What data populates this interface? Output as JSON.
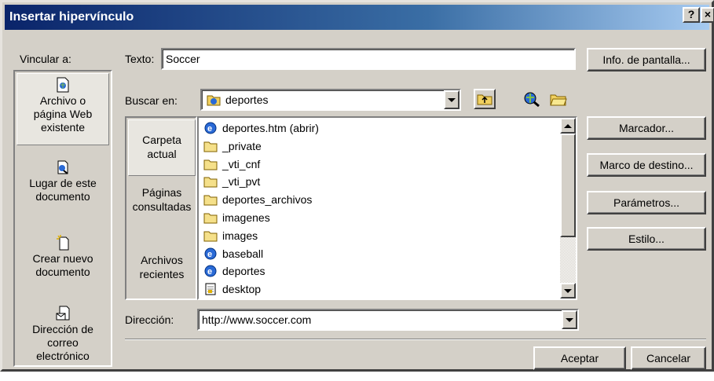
{
  "window": {
    "title": "Insertar hipervínculo",
    "help_label": "?",
    "close_label": "×"
  },
  "link_to": {
    "label": "Vincular a:",
    "items": [
      {
        "line1": "Archivo o",
        "line2": "página Web",
        "line3": "existente",
        "icon": "web-page-icon",
        "selected": true
      },
      {
        "line1": "Lugar de este",
        "line2": "documento",
        "line3": "",
        "icon": "place-in-document-icon",
        "selected": false
      },
      {
        "line1": "Crear nuevo",
        "line2": "documento",
        "line3": "",
        "icon": "new-document-icon",
        "selected": false
      },
      {
        "line1": "Dirección de",
        "line2": "correo",
        "line3": "electrónico",
        "icon": "email-address-icon",
        "selected": false
      }
    ]
  },
  "text_field": {
    "label": "Texto:",
    "value": "Soccer"
  },
  "screen_tip_button": "Info. de pantalla...",
  "look_in": {
    "label": "Buscar en:",
    "value": "deportes",
    "icon": "web-folder-icon"
  },
  "toolbar": {
    "up_folder": "up-folder-icon",
    "browse_web": "browse-web-icon",
    "browse_file": "browse-file-icon"
  },
  "places": [
    {
      "line1": "Carpeta",
      "line2": "actual",
      "selected": true
    },
    {
      "line1": "Páginas",
      "line2": "consultadas",
      "selected": false
    },
    {
      "line1": "Archivos",
      "line2": "recientes",
      "selected": false
    }
  ],
  "files": [
    {
      "name": "deportes.htm (abrir)",
      "icon": "ie-page-icon"
    },
    {
      "name": "_private",
      "icon": "folder-icon"
    },
    {
      "name": "_vti_cnf",
      "icon": "folder-icon"
    },
    {
      "name": "_vti_pvt",
      "icon": "folder-icon"
    },
    {
      "name": "deportes_archivos",
      "icon": "folder-icon"
    },
    {
      "name": "imagenes",
      "icon": "folder-icon"
    },
    {
      "name": "images",
      "icon": "folder-icon"
    },
    {
      "name": "baseball",
      "icon": "ie-page-icon"
    },
    {
      "name": "deportes",
      "icon": "ie-page-icon"
    },
    {
      "name": "desktop",
      "icon": "ini-file-icon"
    }
  ],
  "right_buttons": {
    "bookmark": "Marcador...",
    "target_frame": "Marco de destino...",
    "parameters": "Parámetros...",
    "style": "Estilo..."
  },
  "address": {
    "label": "Dirección:",
    "value": "http://www.soccer.com"
  },
  "footer": {
    "ok": "Aceptar",
    "cancel": "Cancelar"
  },
  "colors": {
    "titlebar_start": "#0a246a",
    "titlebar_end": "#a6caf0",
    "face": "#d4d0c8"
  }
}
